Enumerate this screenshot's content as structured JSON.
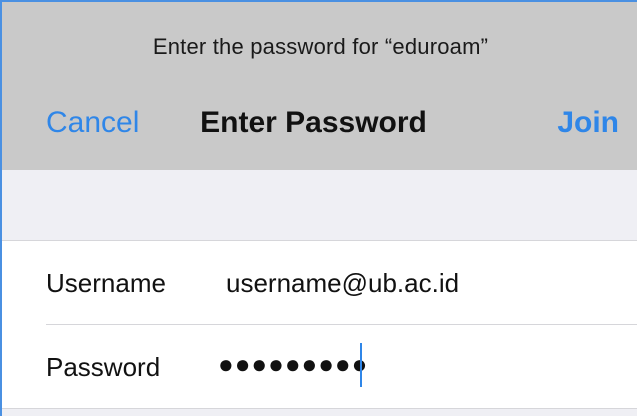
{
  "header": {
    "prompt": "Enter the password for “eduroam”",
    "title": "Enter Password",
    "cancel_label": "Cancel",
    "join_label": "Join"
  },
  "form": {
    "username": {
      "label": "Username",
      "value": "username@ub.ac.id"
    },
    "password": {
      "label": "Password",
      "masked_value": "●●●●●●●●●"
    }
  },
  "colors": {
    "accent": "#2f86e8",
    "header_bg": "#c9c9c9",
    "grouped_bg": "#efeff4"
  }
}
